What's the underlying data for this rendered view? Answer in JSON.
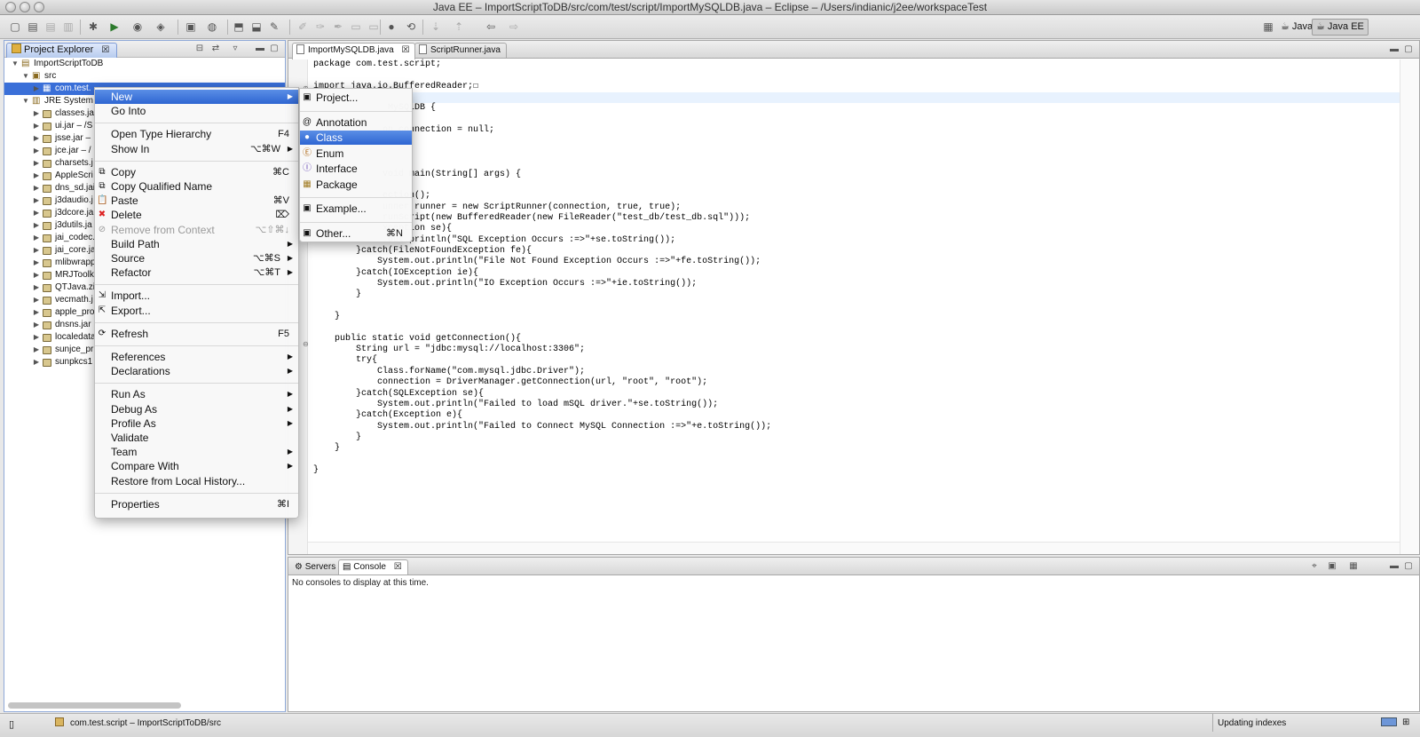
{
  "window": {
    "title": "Java EE – ImportScriptToDB/src/com/test/script/ImportMySQLDB.java – Eclipse – /Users/indianic/j2ee/workspaceTest"
  },
  "toolbar": {
    "perspectives": [
      {
        "label": "Java",
        "active": false
      },
      {
        "label": "Java EE",
        "active": true
      }
    ]
  },
  "project_explorer": {
    "title": "Project Explorer",
    "tree": [
      {
        "label": "ImportScriptToDB",
        "level": 0,
        "expanded": true,
        "icon": "project-icon"
      },
      {
        "label": "src",
        "level": 1,
        "expanded": true,
        "icon": "source-folder-icon"
      },
      {
        "label": "com.test.",
        "level": 2,
        "selected": true,
        "icon": "package-icon"
      },
      {
        "label": "JRE System L",
        "level": 1,
        "expanded": true,
        "icon": "library-icon"
      },
      {
        "label": "classes.ja",
        "level": 2,
        "icon": "jar-icon"
      },
      {
        "label": "ui.jar – /S",
        "level": 2,
        "icon": "jar-icon"
      },
      {
        "label": "jsse.jar –",
        "level": 2,
        "icon": "jar-icon"
      },
      {
        "label": "jce.jar – /",
        "level": 2,
        "icon": "jar-icon"
      },
      {
        "label": "charsets.j",
        "level": 2,
        "icon": "jar-icon"
      },
      {
        "label": "AppleScri",
        "level": 2,
        "icon": "jar-icon"
      },
      {
        "label": "dns_sd.jai",
        "level": 2,
        "icon": "jar-icon"
      },
      {
        "label": "j3daudio.j",
        "level": 2,
        "icon": "jar-icon"
      },
      {
        "label": "j3dcore.ja",
        "level": 2,
        "icon": "jar-icon"
      },
      {
        "label": "j3dutils.ja",
        "level": 2,
        "icon": "jar-icon"
      },
      {
        "label": "jai_codec.",
        "level": 2,
        "icon": "jar-icon"
      },
      {
        "label": "jai_core.ja",
        "level": 2,
        "icon": "jar-icon"
      },
      {
        "label": "mlibwrapp",
        "level": 2,
        "icon": "jar-icon"
      },
      {
        "label": "MRJToolki",
        "level": 2,
        "icon": "jar-icon"
      },
      {
        "label": "QTJava.zi",
        "level": 2,
        "icon": "jar-icon"
      },
      {
        "label": "vecmath.j",
        "level": 2,
        "icon": "jar-icon"
      },
      {
        "label": "apple_pro",
        "level": 2,
        "icon": "jar-icon"
      },
      {
        "label": "dnsns.jar",
        "level": 2,
        "icon": "jar-icon"
      },
      {
        "label": "localedata",
        "level": 2,
        "icon": "jar-icon"
      },
      {
        "label": "sunjce_pr",
        "level": 2,
        "icon": "jar-icon"
      },
      {
        "label": "sunpkcs1",
        "level": 2,
        "icon": "jar-icon"
      }
    ]
  },
  "editor": {
    "tabs": [
      {
        "label": "ImportMySQLDB.java",
        "active": true
      },
      {
        "label": "ScriptRunner.java",
        "active": false
      }
    ],
    "lines": [
      {
        "text": "package com.test.script;",
        "hl": false
      },
      {
        "text": "",
        "hl": false
      },
      {
        "text": "import java.io.BufferedReader;☐",
        "hl": false
      },
      {
        "text": "",
        "hl": true
      },
      {
        "text": "              MySQLDB {",
        "hl": false
      },
      {
        "text": "",
        "hl": false
      },
      {
        "text": "             on connection = null;",
        "hl": false
      },
      {
        "text": "",
        "hl": false
      },
      {
        "text": "",
        "hl": false
      },
      {
        "text": "",
        "hl": false
      },
      {
        "text": "             void main(String[] args) {",
        "hl": false
      },
      {
        "text": "",
        "hl": false
      },
      {
        "text": "             ection();",
        "hl": false
      },
      {
        "text": "             unner runner = new ScriptRunner(connection, true, true);",
        "hl": false
      },
      {
        "text": "             runScript(new BufferedReader(new FileReader(\"test_db/test_db.sql\")));",
        "hl": false
      },
      {
        "text": "             xception se){",
        "hl": false
      },
      {
        "text": "             .out.println(\"SQL Exception Occurs :=>\"+se.toString());",
        "hl": false
      },
      {
        "text": "        }catch(FileNotFoundException fe){",
        "hl": false
      },
      {
        "text": "            System.out.println(\"File Not Found Exception Occurs :=>\"+fe.toString());",
        "hl": false
      },
      {
        "text": "        }catch(IOException ie){",
        "hl": false
      },
      {
        "text": "            System.out.println(\"IO Exception Occurs :=>\"+ie.toString());",
        "hl": false
      },
      {
        "text": "        }",
        "hl": false
      },
      {
        "text": "",
        "hl": false
      },
      {
        "text": "    }",
        "hl": false
      },
      {
        "text": "",
        "hl": false
      },
      {
        "text": "    public static void getConnection(){",
        "hl": false
      },
      {
        "text": "        String url = \"jdbc:mysql://localhost:3306\";",
        "hl": false
      },
      {
        "text": "        try{",
        "hl": false
      },
      {
        "text": "            Class.forName(\"com.mysql.jdbc.Driver\");",
        "hl": false
      },
      {
        "text": "            connection = DriverManager.getConnection(url, \"root\", \"root\");",
        "hl": false
      },
      {
        "text": "        }catch(SQLException se){",
        "hl": false
      },
      {
        "text": "            System.out.println(\"Failed to load mSQL driver.\"+se.toString());",
        "hl": false
      },
      {
        "text": "        }catch(Exception e){",
        "hl": false
      },
      {
        "text": "            System.out.println(\"Failed to Connect MySQL Connection :=>\"+e.toString());",
        "hl": false
      },
      {
        "text": "        }",
        "hl": false
      },
      {
        "text": "    }",
        "hl": false
      },
      {
        "text": "",
        "hl": false
      },
      {
        "text": "}",
        "hl": false
      }
    ]
  },
  "console": {
    "tabs": [
      {
        "label": "Servers",
        "active": false
      },
      {
        "label": "Console",
        "active": true
      }
    ],
    "message": "No consoles to display at this time."
  },
  "status": {
    "left": "com.test.script – ImportScriptToDB/src",
    "right": "Updating indexes"
  },
  "context_menu": [
    {
      "label": "New",
      "submenu": true,
      "selected": true
    },
    {
      "label": "Go Into"
    },
    {
      "sep": true
    },
    {
      "label": "Open Type Hierarchy",
      "shortcut": "F4"
    },
    {
      "label": "Show In",
      "shortcut": "⌥⌘W",
      "submenu": true
    },
    {
      "sep": true
    },
    {
      "label": "Copy",
      "shortcut": "⌘C",
      "icon": "copy-icon"
    },
    {
      "label": "Copy Qualified Name",
      "icon": "copy-qualified-icon"
    },
    {
      "label": "Paste",
      "shortcut": "⌘V",
      "icon": "paste-icon"
    },
    {
      "label": "Delete",
      "shortcut": "⌦",
      "icon": "delete-icon"
    },
    {
      "label": "Remove from Context",
      "shortcut": "⌥⇧⌘↓",
      "disabled": true,
      "icon": "remove-context-icon"
    },
    {
      "label": "Build Path",
      "submenu": true
    },
    {
      "label": "Source",
      "shortcut": "⌥⌘S",
      "submenu": true
    },
    {
      "label": "Refactor",
      "shortcut": "⌥⌘T",
      "submenu": true
    },
    {
      "sep": true
    },
    {
      "label": "Import...",
      "icon": "import-icon"
    },
    {
      "label": "Export...",
      "icon": "export-icon"
    },
    {
      "sep": true
    },
    {
      "label": "Refresh",
      "shortcut": "F5",
      "icon": "refresh-icon"
    },
    {
      "sep": true
    },
    {
      "label": "References",
      "submenu": true
    },
    {
      "label": "Declarations",
      "submenu": true
    },
    {
      "sep": true
    },
    {
      "label": "Run As",
      "submenu": true
    },
    {
      "label": "Debug As",
      "submenu": true
    },
    {
      "label": "Profile As",
      "submenu": true
    },
    {
      "label": "Validate"
    },
    {
      "label": "Team",
      "submenu": true
    },
    {
      "label": "Compare With",
      "submenu": true
    },
    {
      "label": "Restore from Local History..."
    },
    {
      "sep": true
    },
    {
      "label": "Properties",
      "shortcut": "⌘I"
    }
  ],
  "new_submenu": [
    {
      "label": "Project...",
      "icon": "new-project-icon"
    },
    {
      "sep": true
    },
    {
      "label": "Annotation",
      "icon": "annotation-icon"
    },
    {
      "label": "Class",
      "icon": "class-icon",
      "selected": true
    },
    {
      "label": "Enum",
      "icon": "enum-icon"
    },
    {
      "label": "Interface",
      "icon": "interface-icon"
    },
    {
      "label": "Package",
      "icon": "package-icon"
    },
    {
      "sep": true
    },
    {
      "label": "Example...",
      "icon": "example-icon"
    },
    {
      "sep": true
    },
    {
      "label": "Other...",
      "shortcut": "⌘N",
      "icon": "other-wizard-icon"
    }
  ]
}
